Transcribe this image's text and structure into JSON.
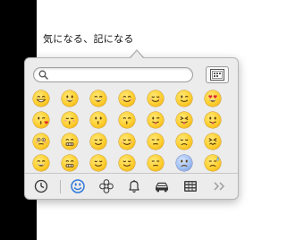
{
  "document": {
    "text": "気になる、記になる"
  },
  "picker": {
    "search": {
      "placeholder": "",
      "value": ""
    },
    "char_viewer_icon": "character-viewer-icon",
    "categories": [
      {
        "name": "recent",
        "icon": "clock-icon",
        "selected": false
      },
      {
        "name": "people",
        "icon": "smiley-icon",
        "selected": true
      },
      {
        "name": "nature",
        "icon": "flower-icon",
        "selected": false
      },
      {
        "name": "objects",
        "icon": "bell-icon",
        "selected": false
      },
      {
        "name": "places",
        "icon": "car-icon",
        "selected": false
      },
      {
        "name": "symbols",
        "icon": "keypad-icon",
        "selected": false
      },
      {
        "name": "more",
        "icon": "double-chevron-right-icon",
        "selected": false
      }
    ],
    "emoji_rows": [
      [
        "grin",
        "smiley",
        "smile",
        "blush",
        "relaxed",
        "wink",
        "heart-eyes"
      ],
      [
        "kissing-heart",
        "kissing-closed-eyes",
        "kissing",
        "kissing-smiling-eyes",
        "stuck-out-tongue-winking-eye",
        "stuck-out-tongue-closed-eyes",
        "stuck-out-tongue"
      ],
      [
        "flushed",
        "grimacing",
        "relieved",
        "relieved-2",
        "unamused",
        "disappointed",
        "confounded"
      ],
      [
        "smile-2",
        "smile-3",
        "smile-4",
        "smile-5",
        "smile-6",
        "fearful",
        "sweat"
      ]
    ]
  }
}
